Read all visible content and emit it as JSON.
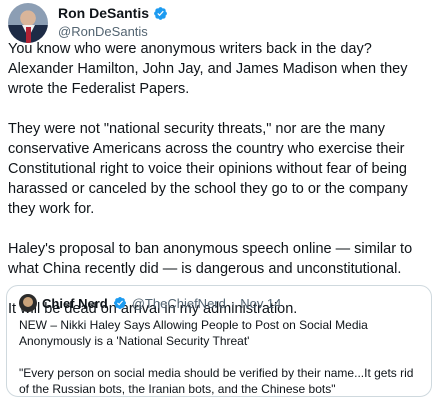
{
  "author": {
    "display_name": "Ron DeSantis",
    "handle": "@RonDeSantis",
    "verified_color": "#1d9bf0"
  },
  "tweet": {
    "paragraphs": [
      "You know who were anonymous writers back in the day? Alexander Hamilton, John Jay, and James Madison when they wrote the Federalist Papers.",
      "They were not \"national security threats,\" nor are the many conservative Americans across the country who exercise their Constitutional right to voice their opinions without fear of being harassed or canceled by the school they go to or the company they work for.",
      "Haley's proposal to ban anonymous speech online — similar to what China recently did —  is dangerous and unconstitutional.",
      "It will be dead on arrival in my administration."
    ]
  },
  "quoted": {
    "display_name": "Chief Nerd",
    "handle": "@TheChiefNerd",
    "separator": "·",
    "date": "Nov 14",
    "paragraphs": [
      "NEW – Nikki Haley Says Allowing People to Post on Social Media Anonymously is a 'National Security Threat'",
      "\"Every person on social media should be verified by their name...It gets rid of the Russian bots, the Iranian bots, and the Chinese bots\""
    ]
  }
}
